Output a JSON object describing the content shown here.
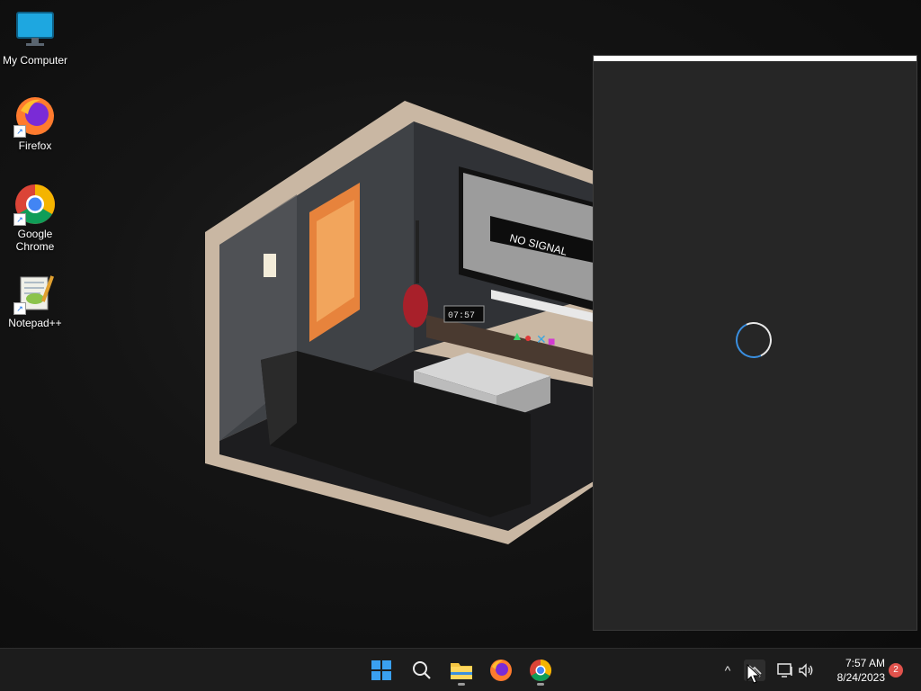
{
  "desktop": {
    "icons": [
      {
        "label": "My Computer",
        "icon": "monitor-icon"
      },
      {
        "label": "Firefox",
        "icon": "firefox-icon"
      },
      {
        "label": "Google Chrome",
        "icon": "chrome-icon"
      },
      {
        "label": "Notepad++",
        "icon": "notepadpp-icon"
      }
    ],
    "wallpaper": {
      "tv_text": "NO SIGNAL",
      "clock_text": "07:57"
    }
  },
  "window": {
    "state": "loading",
    "accent": "#3a8fe0"
  },
  "taskbar": {
    "apps": [
      "start-icon",
      "search-icon",
      "file-explorer-icon",
      "firefox-icon",
      "chrome-icon"
    ],
    "tray": {
      "chevron": "^",
      "clock_time": "7:57 AM",
      "clock_date": "8/24/2023",
      "notifications": "2"
    }
  },
  "colors": {
    "taskbar_bg": "#1c1c1c",
    "panel_bg": "#262626",
    "badge": "#e0524c"
  }
}
